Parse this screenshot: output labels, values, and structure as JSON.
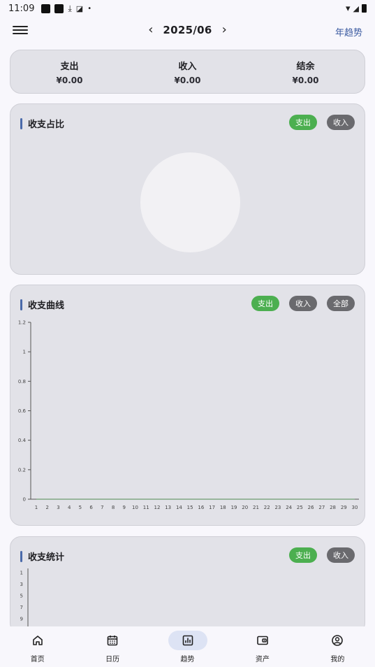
{
  "status": {
    "time": "11:09"
  },
  "header": {
    "month": "2025/06",
    "year_trend": "年趋势",
    "prev": "‹",
    "next": "›"
  },
  "summary": [
    {
      "title": "支出",
      "value": "¥0.00"
    },
    {
      "title": "收入",
      "value": "¥0.00"
    },
    {
      "title": "结余",
      "value": "¥0.00"
    }
  ],
  "pie_card": {
    "title": "收支占比",
    "chips": [
      "支出",
      "收入"
    ]
  },
  "curve_card": {
    "title": "收支曲线",
    "chips": [
      "支出",
      "收入",
      "全部"
    ]
  },
  "stat_card": {
    "title": "收支统计",
    "chips": [
      "支出",
      "收入"
    ]
  },
  "chart_data": [
    {
      "type": "line",
      "x": [
        1,
        2,
        3,
        4,
        5,
        6,
        7,
        8,
        9,
        10,
        11,
        12,
        13,
        14,
        15,
        16,
        17,
        18,
        19,
        20,
        21,
        22,
        23,
        24,
        25,
        26,
        27,
        28,
        29,
        30
      ],
      "series": [
        {
          "values": [
            0,
            0,
            0,
            0,
            0,
            0,
            0,
            0,
            0,
            0,
            0,
            0,
            0,
            0,
            0,
            0,
            0,
            0,
            0,
            0,
            0,
            0,
            0,
            0,
            0,
            0,
            0,
            0,
            0,
            0
          ]
        }
      ],
      "y_ticks": [
        "0",
        "0.2",
        "0.4",
        "0.6",
        "0.8",
        "1",
        "1.2"
      ],
      "ylim": [
        0,
        1.2
      ]
    },
    {
      "type": "bar",
      "y_ticks": [
        "1",
        "3",
        "5",
        "7",
        "9"
      ],
      "values": []
    }
  ],
  "nav": [
    {
      "label": "首页",
      "icon": "home-icon"
    },
    {
      "label": "日历",
      "icon": "calendar-icon"
    },
    {
      "label": "趋势",
      "icon": "trend-icon",
      "active": true
    },
    {
      "label": "资产",
      "icon": "wallet-icon"
    },
    {
      "label": "我的",
      "icon": "profile-icon"
    }
  ],
  "colors": {
    "active_chip": "#4caf50",
    "inactive_chip": "#6a6a6e",
    "accent": "#3a5aa0"
  }
}
